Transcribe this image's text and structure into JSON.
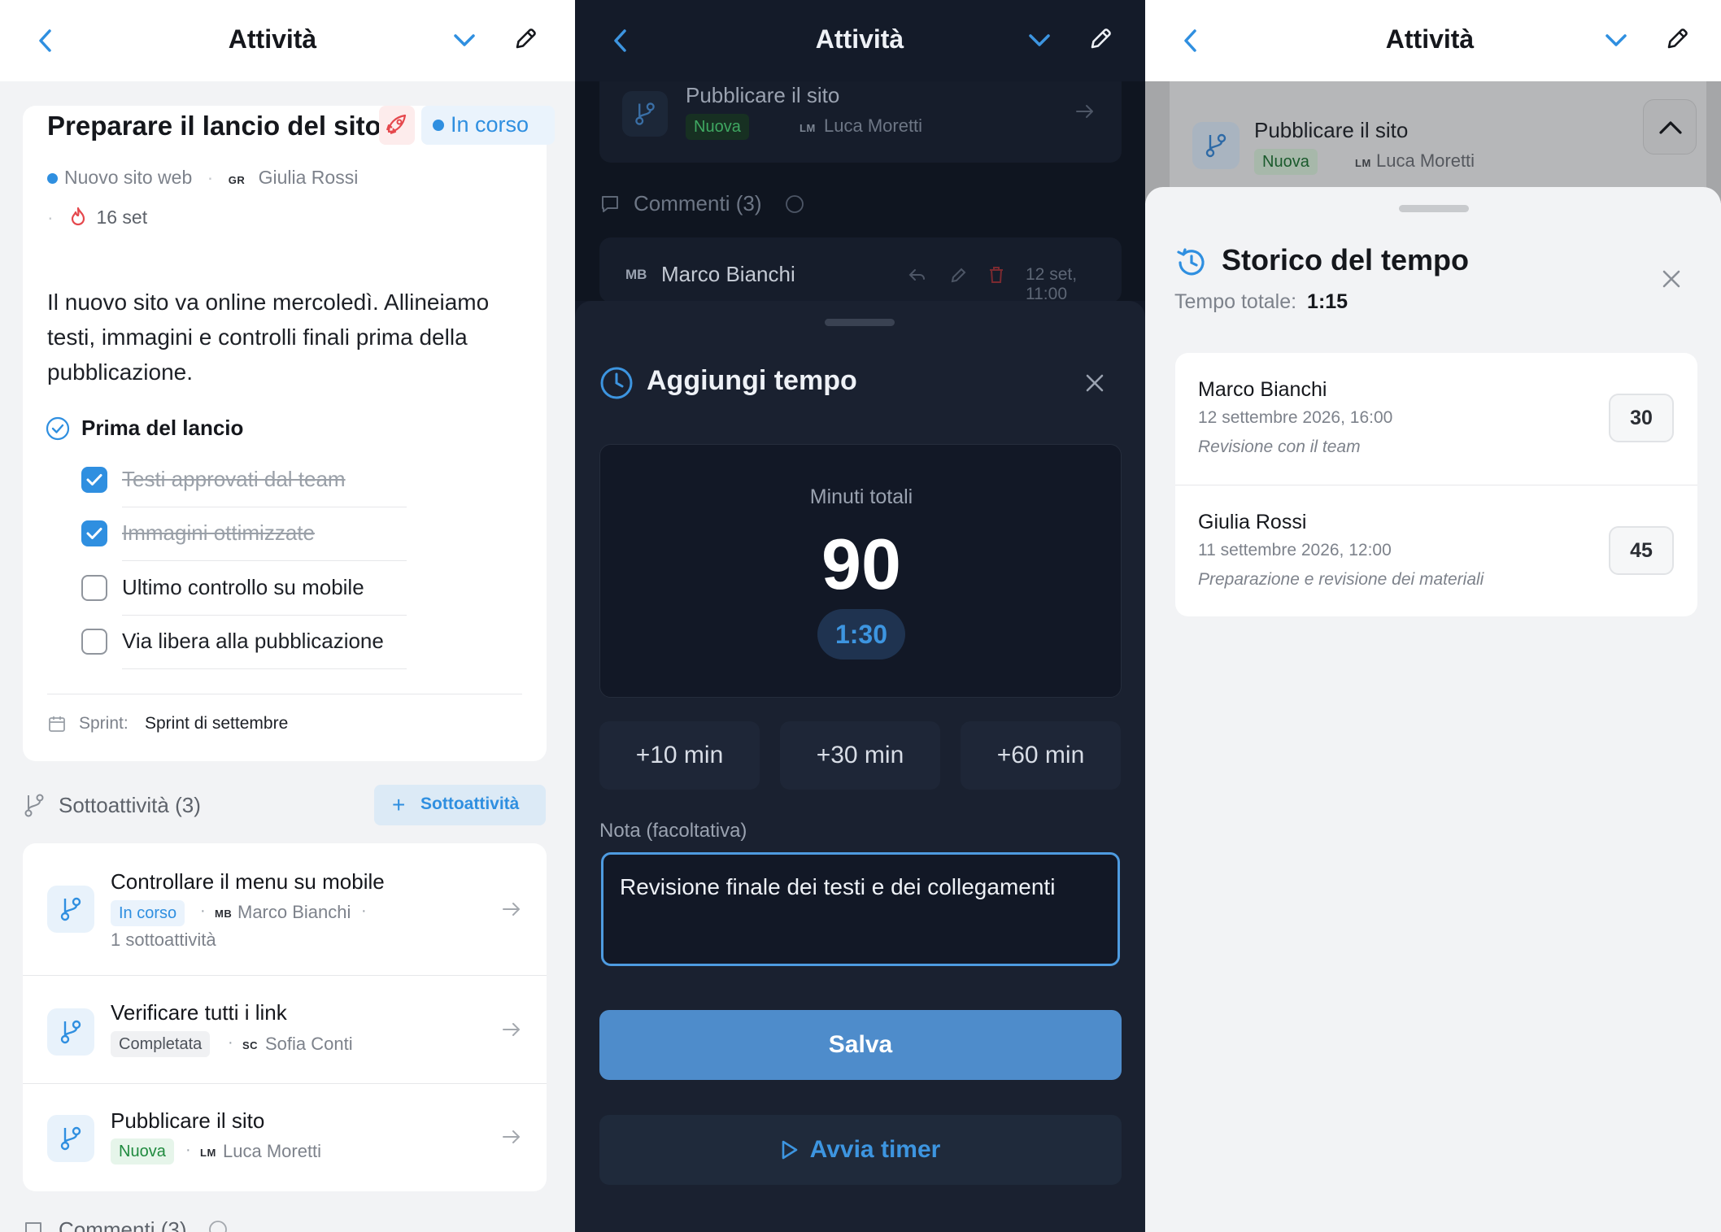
{
  "colors": {
    "accent": "#2f8fe0",
    "in_progress": "#2f8fe0",
    "new_green": "#1f8a3e",
    "danger": "#e5484d",
    "dark_bg": "#121826",
    "save_button": "#4e8ccb"
  },
  "header": {
    "title": "Attività"
  },
  "task": {
    "title": "Preparare il lancio del sito",
    "status": "In corso",
    "project": "Nuovo sito web",
    "assignee_initials": "GR",
    "assignee": "Giulia Rossi",
    "due": "16 set",
    "description": "Il nuovo sito va online mercoledì. Allineiamo testi, immagini e controlli finali prima della pubblicazione.",
    "checklist": {
      "title": "Prima del lancio",
      "items": [
        {
          "label": "Testi approvati dal team",
          "done": true
        },
        {
          "label": "Immagini ottimizzate",
          "done": true
        },
        {
          "label": "Ultimo controllo su mobile",
          "done": false
        },
        {
          "label": "Via libera alla pubblicazione",
          "done": false
        }
      ]
    },
    "sprint_label": "Sprint:",
    "sprint_value": "Sprint di settembre"
  },
  "subtasks": {
    "header": "Sottoattività (3)",
    "add_label": "Sottoattività",
    "items": [
      {
        "title": "Controllare il menu su mobile",
        "status": "In corso",
        "initials": "MB",
        "assignee": "Marco Bianchi",
        "extra": "1 sottoattività"
      },
      {
        "title": "Verificare tutti i link",
        "status": "Completata",
        "initials": "SC",
        "assignee": "Sofia Conti"
      },
      {
        "title": "Pubblicare il sito",
        "status": "Nuova",
        "initials": "LM",
        "assignee": "Luca Moretti"
      }
    ]
  },
  "comments": {
    "header": "Commenti (3)",
    "first": {
      "initials": "MB",
      "author": "Marco Bianchi",
      "time": "12 set, 11:00"
    }
  },
  "add_time": {
    "title": "Aggiungi tempo",
    "total_label": "Minuti totali",
    "total_minutes": "90",
    "formatted": "1:30",
    "quick": [
      "+10 min",
      "+30 min",
      "+60 min"
    ],
    "note_label": "Nota (facoltativa)",
    "note_value": "Revisione finale dei testi e dei collegamenti",
    "save_label": "Salva",
    "timer_label": "Avvia timer"
  },
  "history": {
    "title": "Storico del tempo",
    "total_label": "Tempo totale:",
    "total_value": "1:15",
    "entries": [
      {
        "name": "Marco Bianchi",
        "date": "12 settembre 2026, 16:00",
        "note": "Revisione con il team",
        "minutes": "30"
      },
      {
        "name": "Giulia Rossi",
        "date": "11 settembre 2026, 12:00",
        "note": "Preparazione e revisione dei materiali",
        "minutes": "45"
      }
    ]
  }
}
